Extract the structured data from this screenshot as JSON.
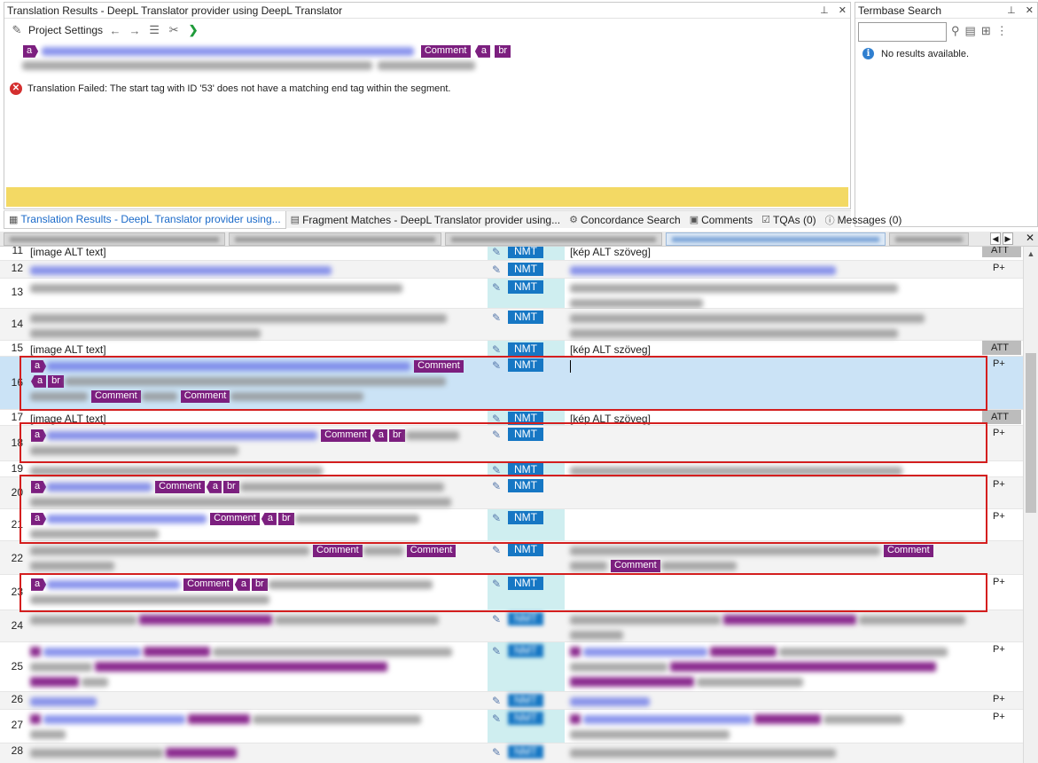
{
  "translation_panel": {
    "title": "Translation Results - DeepL Translator provider using DeepL Translator",
    "toolbar": {
      "settings_label": "Project Settings"
    },
    "source_tags": {
      "a": "a",
      "comment": "Comment",
      "br": "br"
    },
    "error_text": "Translation Failed: The start tag with ID '53' does not have a matching end tag within the segment."
  },
  "termbase_panel": {
    "title": "Termbase Search",
    "no_results": "No results available."
  },
  "panel_tabs": [
    {
      "label": "Translation Results - DeepL Translator provider using...",
      "icon": "translation-icon"
    },
    {
      "label": "Fragment Matches - DeepL Translator provider using...",
      "icon": "fragment-icon"
    },
    {
      "label": "Concordance Search",
      "icon": "concordance-icon"
    },
    {
      "label": "Comments",
      "icon": "comments-icon"
    },
    {
      "label": "TQAs (0)",
      "icon": "tqa-icon"
    },
    {
      "label": "Messages (0)",
      "icon": "messages-icon"
    }
  ],
  "labels": {
    "tag_a": "a",
    "tag_br": "br",
    "tag_comment": "Comment",
    "nmt": "NMT",
    "p_plus": "P+",
    "att": "ATT"
  },
  "rows": [
    {
      "num": "11",
      "source": "[image ALT text]",
      "target": "[kép ALT szöveg]",
      "flag": "ATT"
    },
    {
      "num": "12",
      "flag": "P+"
    },
    {
      "num": "13"
    },
    {
      "num": "14"
    },
    {
      "num": "15",
      "source": "[image ALT text]",
      "target": "[kép ALT szöveg]",
      "flag": "ATT"
    },
    {
      "num": "16",
      "flag": "P+"
    },
    {
      "num": "17",
      "source": "[image ALT text]",
      "target": "[kép ALT szöveg]",
      "flag": "ATT"
    },
    {
      "num": "18",
      "flag": "P+"
    },
    {
      "num": "19"
    },
    {
      "num": "20",
      "flag": "P+"
    },
    {
      "num": "21",
      "flag": "P+"
    },
    {
      "num": "22"
    },
    {
      "num": "23",
      "flag": "P+"
    },
    {
      "num": "24"
    },
    {
      "num": "25",
      "flag": "P+"
    },
    {
      "num": "26",
      "flag": "P+"
    },
    {
      "num": "27",
      "flag": "P+"
    },
    {
      "num": "28"
    }
  ]
}
